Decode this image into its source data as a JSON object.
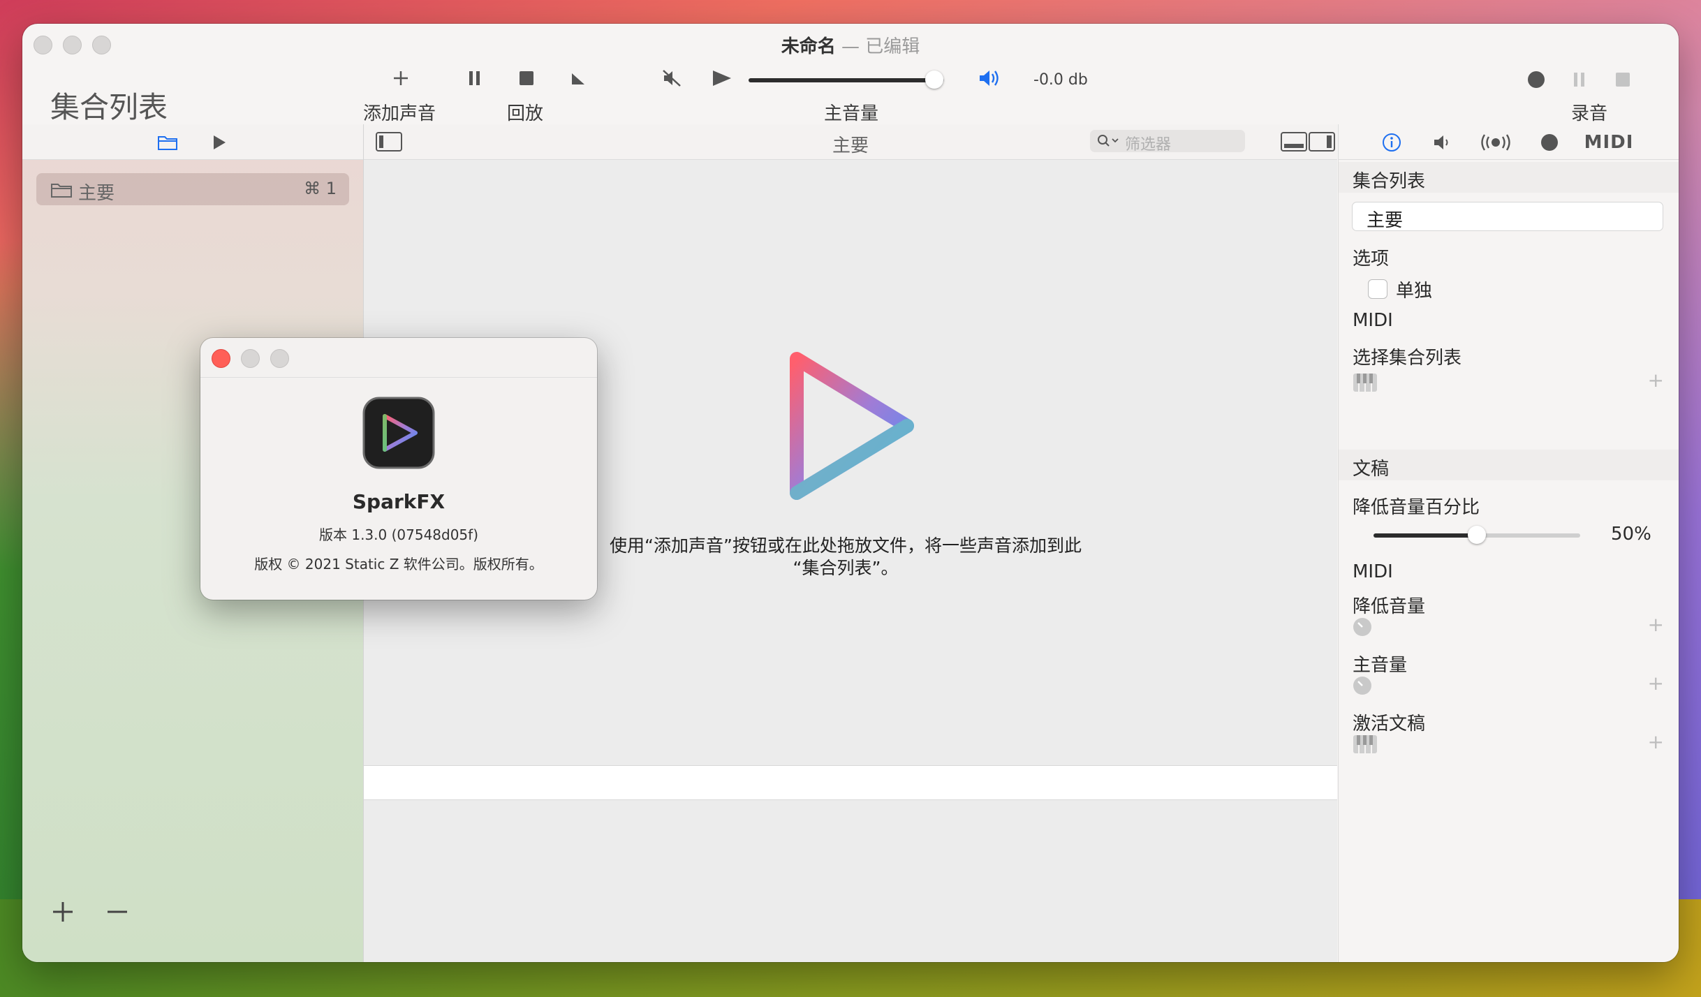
{
  "window": {
    "title": "未命名",
    "separator": "—",
    "status": "已编辑"
  },
  "toolbar": {
    "add_sound_label": "添加声音",
    "playback_label": "回放",
    "master_volume_label": "主音量",
    "record_label": "录音",
    "volume_db": "-0.0 db",
    "volume_level": 0.95
  },
  "sidebar": {
    "title": "集合列表",
    "items": [
      {
        "label": "主要",
        "shortcut": "⌘ 1"
      }
    ]
  },
  "main": {
    "header_title": "主要",
    "filter_placeholder": "筛选器",
    "hint_line1": "使用“添加声音”按钮或在此处拖放文件，将一些声音添加到此",
    "hint_line2": "“集合列表”。"
  },
  "inspector": {
    "tabs": [
      "info-icon",
      "speaker-icon",
      "broadcast-icon",
      "record-icon",
      "midi-icon"
    ],
    "midi_tab_text": "MIDI",
    "section_setlist": "集合列表",
    "setlist_name": "主要",
    "options_label": "选项",
    "solo_label": "单独",
    "midi_label_1": "MIDI",
    "select_setlist_label": "选择集合列表",
    "section_script": "文稿",
    "duck_percent_label": "降低音量百分比",
    "duck_percent_value": "50%",
    "duck_percent_level": 0.5,
    "midi_label_2": "MIDI",
    "duck_volume_label": "降低音量",
    "master_volume_label": "主音量",
    "activate_script_label": "激活文稿",
    "plus": "+"
  },
  "about": {
    "app_name": "SparkFX",
    "version": "版本 1.3.0 (07548d05f)",
    "copyright": "版权 © 2021 Static Z 软件公司。版权所有。"
  },
  "colors": {
    "accent": "#1e6ff0",
    "close": "#ff5f57",
    "play_gradient": [
      "#ff5f6d",
      "#4f8ef7",
      "#5fd068"
    ]
  }
}
